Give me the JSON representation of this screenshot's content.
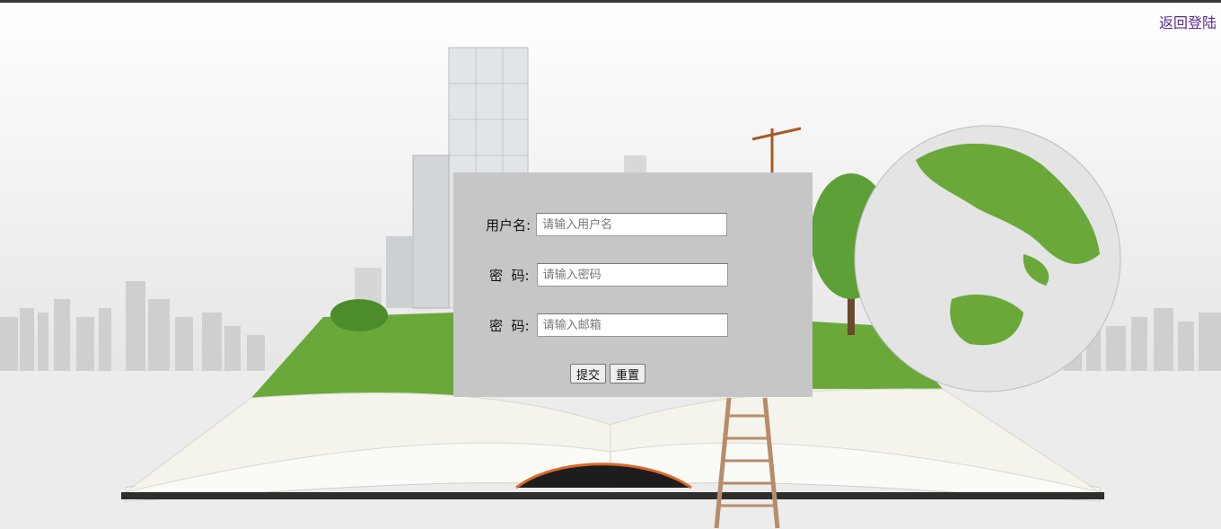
{
  "header": {
    "back_link": "返回登陆"
  },
  "form": {
    "username": {
      "label": "用户名:",
      "placeholder": "请输入用户名"
    },
    "password": {
      "label": "密  码:",
      "placeholder": "请输入密码"
    },
    "email": {
      "label": "密  码:",
      "placeholder": "请输入邮箱"
    },
    "submit_label": "提交",
    "reset_label": "重置"
  },
  "colors": {
    "panel_bg": "#c6c6c6",
    "link": "#5d2a8c",
    "grass": "#6aa83a"
  },
  "icons": [
    "globe-illustration",
    "open-book-illustration",
    "skyscraper-illustration",
    "ladder-illustration",
    "tree-illustration"
  ]
}
